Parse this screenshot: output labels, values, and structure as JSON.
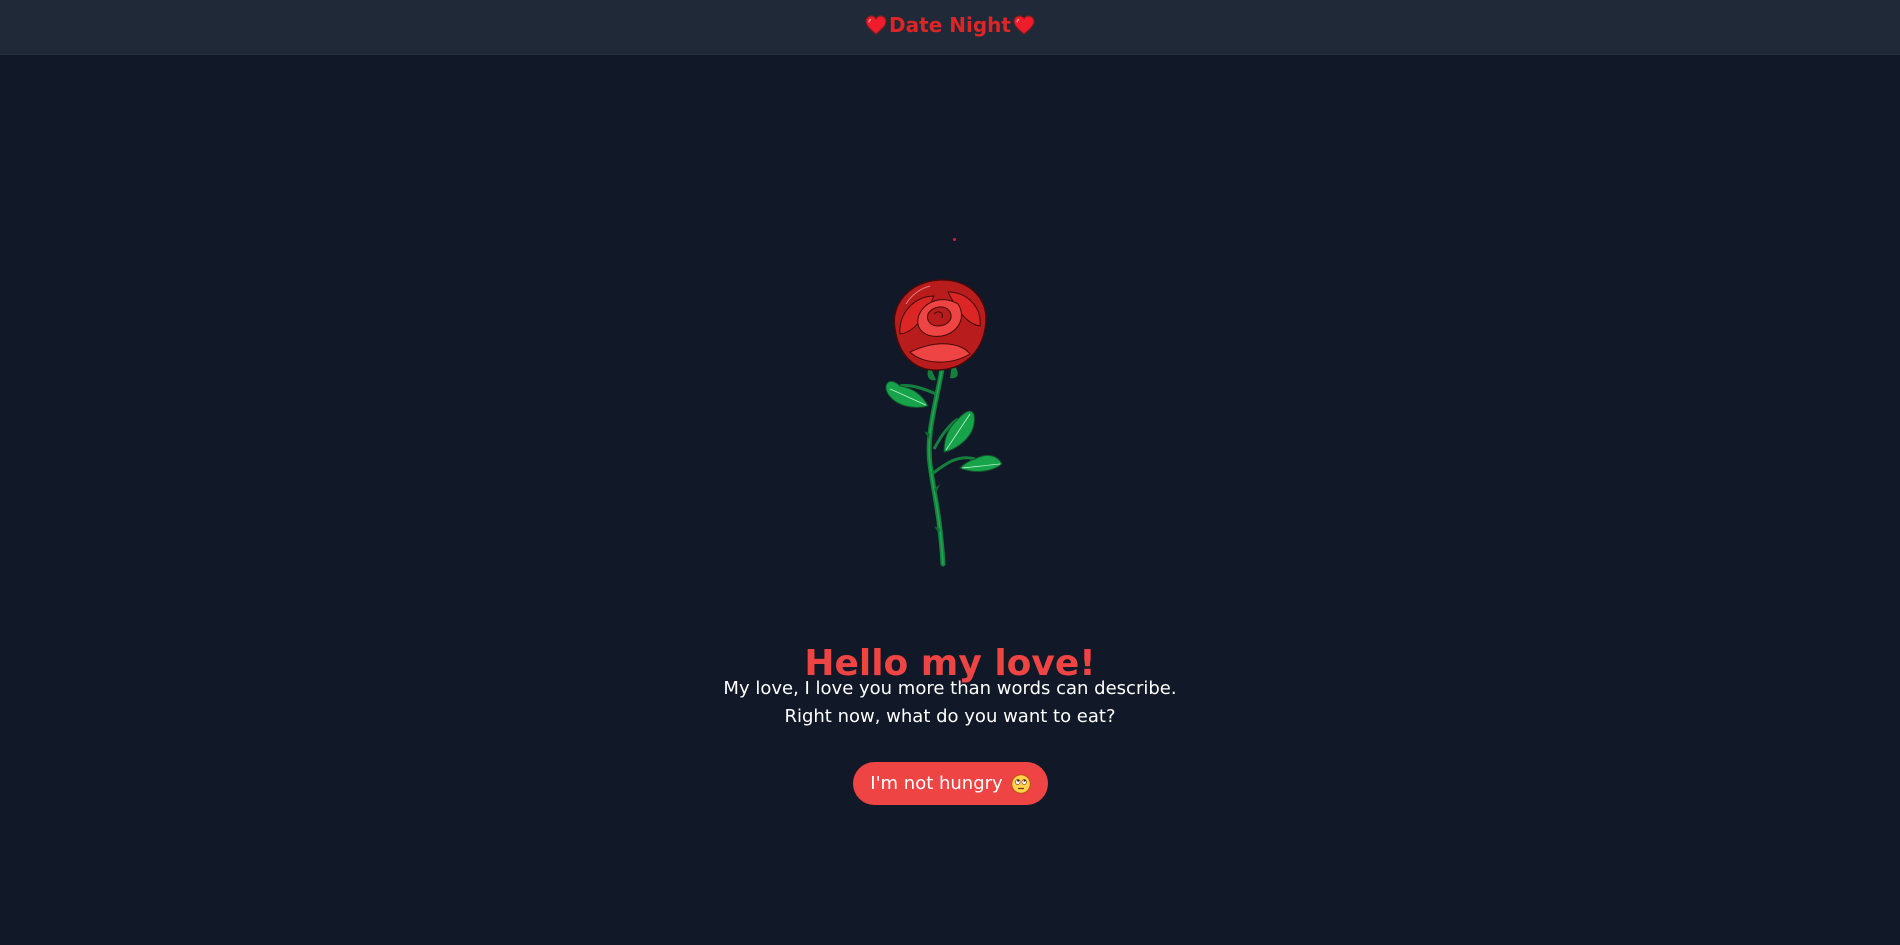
{
  "header": {
    "title": "Date Night",
    "left_icon": "heart-icon",
    "right_icon": "heart-icon"
  },
  "hero": {
    "image": "rose-illustration",
    "heading": "Hello my love!",
    "message_line1": "My love, I love you more than words can describe.",
    "message_line2": "Right now, what do you want to eat?",
    "button_label": "I'm not hungry",
    "button_icon": "eye-roll-emoji-icon"
  },
  "colors": {
    "background": "#111827",
    "header": "#1f2937",
    "accent": "#ef4444",
    "brand": "#dc2626"
  }
}
